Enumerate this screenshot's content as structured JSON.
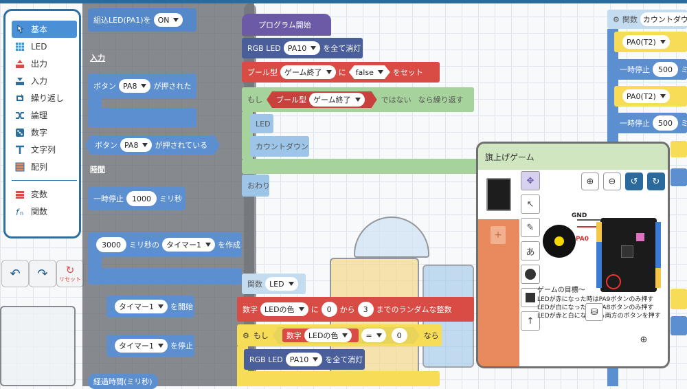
{
  "categories": [
    {
      "label": "基本",
      "icon": "pointer-icon",
      "selected": true
    },
    {
      "label": "LED",
      "icon": "led-grid-icon",
      "selected": false
    },
    {
      "label": "出力",
      "icon": "output-icon",
      "selected": false
    },
    {
      "label": "入力",
      "icon": "input-icon",
      "selected": false
    },
    {
      "label": "繰り返し",
      "icon": "loop-icon",
      "selected": false
    },
    {
      "label": "論理",
      "icon": "logic-icon",
      "selected": false
    },
    {
      "label": "数字",
      "icon": "dice-icon",
      "selected": false
    },
    {
      "label": "文字列",
      "icon": "text-icon",
      "selected": false
    },
    {
      "label": "配列",
      "icon": "array-icon",
      "selected": false
    }
  ],
  "categories2": [
    {
      "label": "変数",
      "icon": "variable-icon"
    },
    {
      "label": "関数",
      "icon": "function-icon"
    }
  ],
  "toolbar": {
    "reset_label": "リセット"
  },
  "flyout": {
    "builtin_led": "組込LED(PA1)を",
    "builtin_led_value": "ON",
    "section_input": "入力",
    "button_pressed_prefix": "ボタン",
    "button_pressed_pin": "PA8",
    "button_pressed_suffix": "が押された",
    "button_pressing_prefix": "ボタン",
    "button_pressing_pin": "PA8",
    "button_pressing_suffix": "が押されている",
    "section_time": "時間",
    "pause_label": "一時停止",
    "pause_value": "1000",
    "pause_unit": "ミリ秒",
    "timer_ms": "3000",
    "timer_ms_label": "ミリ秒の",
    "timer_name": "タイマー1",
    "timer_create": "を作成",
    "timer_start_name": "タイマー1",
    "timer_start": "を開始",
    "timer_stop_name": "タイマー1",
    "timer_stop": "を停止",
    "elapsed": "経過時間(ミリ秒)"
  },
  "workspace": {
    "program_start": "プログラム開始",
    "rgb_label": "RGB LED",
    "rgb_pin": "PA10",
    "rgb_off": "を全て消灯",
    "bool_type": "ブール型",
    "game_end": "ゲーム終了",
    "ni": "に",
    "false_value": "false",
    "set_label": "をセット",
    "if_label": "もし",
    "not_label": "ではない",
    "repeat_label": "なら繰り返す",
    "led_call": "LED",
    "countdown_call": "カウントダウン",
    "end_label": "おわり",
    "func_label": "関数",
    "func_name": "LED",
    "num_type": "数字",
    "led_color": "LEDの色",
    "from_value": "0",
    "from_label": "から",
    "to_value": "3",
    "random_label": "までのランダムな整数",
    "if2_label": "もし",
    "eq_op": "=",
    "eq_value": "0",
    "nara": "なら",
    "rgb2_label": "RGB LED",
    "rgb2_pin": "PA10",
    "rgb2_off": "を全て消灯",
    "right_func_label": "関数",
    "right_func_name": "カウントダウ",
    "right_pin1": "PA0(T2)",
    "right_pause1": "一時停止",
    "right_val1": "500",
    "right_pin2": "PA0(T2)",
    "right_pause2": "一時停止",
    "right_val2": "500",
    "right_unit": "ミ"
  },
  "game": {
    "title": "旗上げゲーム",
    "goal_title": "ゲームの目標～",
    "rule1": "LEDが赤になった時はPA9ボタンのみ押す",
    "rule2": "LEDが白になった時はPA8ボタンのみ押す",
    "rule3": "LEDが赤と白になったら両方のボタンを押す",
    "gnd_label": "GND",
    "pa0_label": "PA0",
    "tools": [
      "move-icon",
      "arrow-pointer-icon",
      "eraser-icon",
      "text-tool-icon",
      "circle-tool-icon",
      "square-tool-icon",
      "arrow-up-icon"
    ],
    "tool_text": "あ"
  },
  "colors": {
    "accent": "#2b6e9f",
    "flyout_block": "#5b8fd0",
    "red_block": "#d94b45",
    "green_block": "#a6d29c",
    "game_bg": "#e88a5d"
  }
}
